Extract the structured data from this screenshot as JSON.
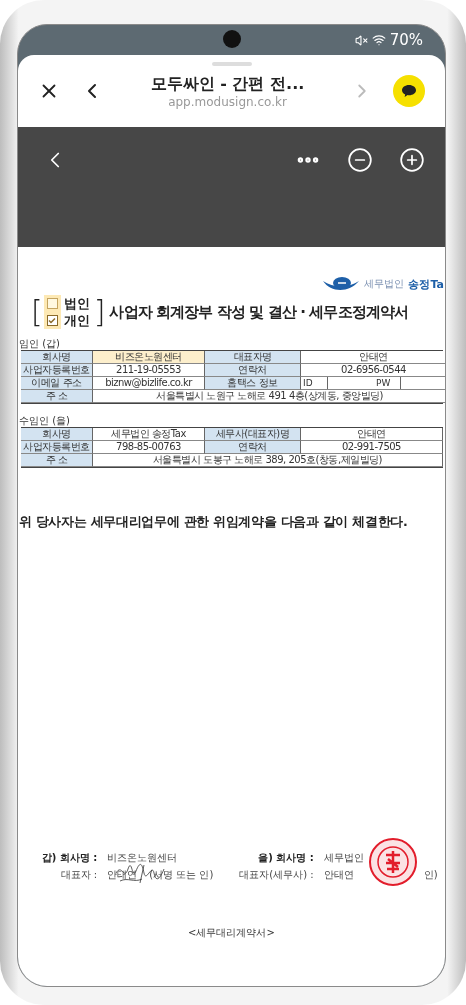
{
  "status_bar": {
    "battery": "70%"
  },
  "browser": {
    "title": "모두싸인 - 간편 전...",
    "url": "app.modusign.co.kr"
  },
  "document": {
    "logo_text": "세무법인",
    "logo_name": "송정Ta",
    "brackets": [
      "[",
      "]"
    ],
    "title_options": [
      {
        "label": "법인",
        "checked": false
      },
      {
        "label": "개인",
        "checked": true
      }
    ],
    "title": "사업자 회계장부 작성 및 결산 · 세무조정계약서",
    "parties": [
      {
        "heading": "임인 (갑)",
        "rows": [
          {
            "kind": "pair",
            "cells": [
              {
                "text": "회사명",
                "kind": "label"
              },
              {
                "text": "비즈온노원센터",
                "kind": "highlight"
              },
              {
                "text": "대표자명",
                "kind": "label"
              },
              {
                "text": "안태연",
                "kind": "value"
              }
            ]
          },
          {
            "kind": "pair",
            "cells": [
              {
                "text": "사업자등록번호",
                "kind": "label"
              },
              {
                "text": "211-19-05553",
                "kind": "value"
              },
              {
                "text": "연락처",
                "kind": "label"
              },
              {
                "text": "02-6956-0544",
                "kind": "value"
              }
            ]
          },
          {
            "kind": "pair",
            "cells": [
              {
                "text": "이메일 주소",
                "kind": "label"
              },
              {
                "text": "biznw@bizlife.co.kr",
                "kind": "value"
              },
              {
                "text": "홈택스 정보",
                "kind": "label"
              },
              {
                "kind": "login",
                "labels": [
                  "ID",
                  "PW"
                ]
              }
            ]
          },
          {
            "kind": "address",
            "cells": [
              {
                "text": "주 소",
                "kind": "label"
              },
              {
                "text": "서울특별시 노원구 노해로 491 4층(상계동, 중앙빌딩)",
                "kind": "value"
              }
            ]
          }
        ]
      },
      {
        "heading": "수임인 (을)",
        "rows": [
          {
            "kind": "pair",
            "cells": [
              {
                "text": "회사명",
                "kind": "label"
              },
              {
                "text": "세무법인 송정Tax",
                "kind": "value"
              },
              {
                "text": "세무사(대표자)명",
                "kind": "label"
              },
              {
                "text": "안태연",
                "kind": "value"
              }
            ]
          },
          {
            "kind": "pair",
            "cells": [
              {
                "text": "사업자등록번호",
                "kind": "label"
              },
              {
                "text": "798-85-00763",
                "kind": "value"
              },
              {
                "text": "연락처",
                "kind": "label"
              },
              {
                "text": "02-991-7505",
                "kind": "value"
              }
            ]
          },
          {
            "kind": "address",
            "cells": [
              {
                "text": "주 소",
                "kind": "label"
              },
              {
                "text": "서울특별시 도봉구 노해로 389, 205호(창동,제일빌딩)",
                "kind": "value"
              }
            ]
          }
        ]
      }
    ],
    "statement": "위 당사자는 세무대리업무에 관한 위임계약을 다음과 같이 체결한다.",
    "signatures": [
      {
        "kind": "signed",
        "company_label": "갑) 회사명 :",
        "company": "비즈온노원센터",
        "rep_label": "대표자 :",
        "rep": "안태연",
        "sign_note": "(서명 또는 인)"
      },
      {
        "kind": "sealed",
        "company_label": "을) 회사명 :",
        "company": "세무법인",
        "rep_label": "대표자(세무사) :",
        "rep": "안태연",
        "sign_note": "인)"
      }
    ],
    "footer": "<세무대리계약서>"
  }
}
